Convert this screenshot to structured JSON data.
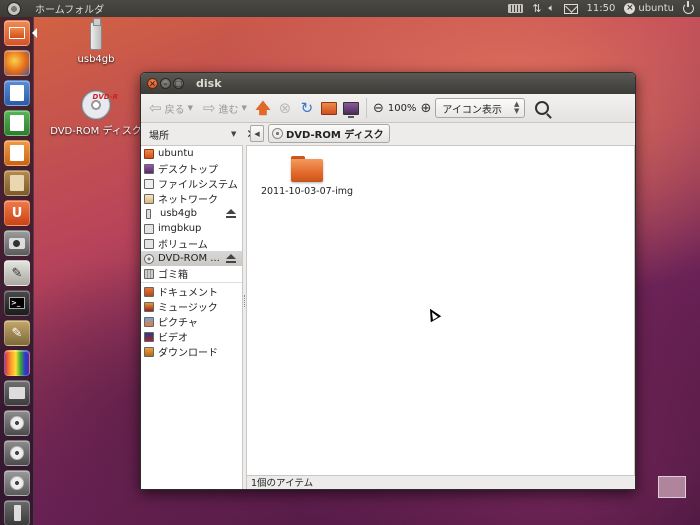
{
  "top_panel": {
    "title": "ホームフォルダ",
    "clock": "11:50",
    "user": "ubuntu"
  },
  "launcher": {
    "items": [
      "home-folder",
      "firefox",
      "libreoffice-writer",
      "libreoffice-calc",
      "libreoffice-impress",
      "ubuntu-software-center",
      "ubuntu-one",
      "shotwell",
      "text-editor",
      "terminal",
      "gimp",
      "color-pencils",
      "screenshot",
      "disk-drive",
      "disk-drive",
      "dvd-drive",
      "usb-drive"
    ],
    "terminal_glyph": ">_"
  },
  "desktop": {
    "usb_label": "usb4gb",
    "dvd_label": "DVD-ROM ディスク",
    "dvd_badge": "DVD-R"
  },
  "window": {
    "title": "disk",
    "close_glyph": "×",
    "min_glyph": "–",
    "max_glyph": "□",
    "toolbar": {
      "back_label": "戻る",
      "forward_label": "進む",
      "zoom_value": "100%",
      "view_mode": "アイコン表示"
    },
    "places_label": "場所",
    "path_button": "DVD-ROM ディスク",
    "sidebar": {
      "devices": [
        {
          "label": "ubuntu"
        },
        {
          "label": "デスクトップ"
        },
        {
          "label": "ファイルシステム"
        },
        {
          "label": "ネットワーク"
        },
        {
          "label": "usb4gb"
        },
        {
          "label": "imgbkup"
        },
        {
          "label": "ボリューム"
        },
        {
          "label": "DVD-ROM ..."
        },
        {
          "label": "ゴミ箱"
        }
      ],
      "bookmarks": [
        {
          "label": "ドキュメント"
        },
        {
          "label": "ミュージック"
        },
        {
          "label": "ピクチャ"
        },
        {
          "label": "ビデオ"
        },
        {
          "label": "ダウンロード"
        }
      ]
    },
    "files": [
      {
        "name": "2011-10-03-07-img"
      }
    ],
    "status": "1個のアイテム"
  },
  "colors": {
    "accent": "#dd4814",
    "panel": "#3c3b37",
    "folder": "#e26a2b"
  }
}
